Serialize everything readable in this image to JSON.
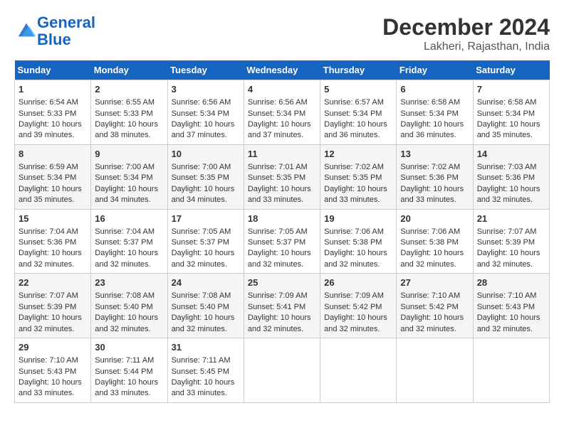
{
  "header": {
    "logo_line1": "General",
    "logo_line2": "Blue",
    "title": "December 2024",
    "subtitle": "Lakheri, Rajasthan, India"
  },
  "days_of_week": [
    "Sunday",
    "Monday",
    "Tuesday",
    "Wednesday",
    "Thursday",
    "Friday",
    "Saturday"
  ],
  "weeks": [
    [
      {
        "day": "1",
        "sunrise": "6:54 AM",
        "sunset": "5:33 PM",
        "daylight": "10 hours and 39 minutes."
      },
      {
        "day": "2",
        "sunrise": "6:55 AM",
        "sunset": "5:33 PM",
        "daylight": "10 hours and 38 minutes."
      },
      {
        "day": "3",
        "sunrise": "6:56 AM",
        "sunset": "5:34 PM",
        "daylight": "10 hours and 37 minutes."
      },
      {
        "day": "4",
        "sunrise": "6:56 AM",
        "sunset": "5:34 PM",
        "daylight": "10 hours and 37 minutes."
      },
      {
        "day": "5",
        "sunrise": "6:57 AM",
        "sunset": "5:34 PM",
        "daylight": "10 hours and 36 minutes."
      },
      {
        "day": "6",
        "sunrise": "6:58 AM",
        "sunset": "5:34 PM",
        "daylight": "10 hours and 36 minutes."
      },
      {
        "day": "7",
        "sunrise": "6:58 AM",
        "sunset": "5:34 PM",
        "daylight": "10 hours and 35 minutes."
      }
    ],
    [
      {
        "day": "8",
        "sunrise": "6:59 AM",
        "sunset": "5:34 PM",
        "daylight": "10 hours and 35 minutes."
      },
      {
        "day": "9",
        "sunrise": "7:00 AM",
        "sunset": "5:34 PM",
        "daylight": "10 hours and 34 minutes."
      },
      {
        "day": "10",
        "sunrise": "7:00 AM",
        "sunset": "5:35 PM",
        "daylight": "10 hours and 34 minutes."
      },
      {
        "day": "11",
        "sunrise": "7:01 AM",
        "sunset": "5:35 PM",
        "daylight": "10 hours and 33 minutes."
      },
      {
        "day": "12",
        "sunrise": "7:02 AM",
        "sunset": "5:35 PM",
        "daylight": "10 hours and 33 minutes."
      },
      {
        "day": "13",
        "sunrise": "7:02 AM",
        "sunset": "5:36 PM",
        "daylight": "10 hours and 33 minutes."
      },
      {
        "day": "14",
        "sunrise": "7:03 AM",
        "sunset": "5:36 PM",
        "daylight": "10 hours and 32 minutes."
      }
    ],
    [
      {
        "day": "15",
        "sunrise": "7:04 AM",
        "sunset": "5:36 PM",
        "daylight": "10 hours and 32 minutes."
      },
      {
        "day": "16",
        "sunrise": "7:04 AM",
        "sunset": "5:37 PM",
        "daylight": "10 hours and 32 minutes."
      },
      {
        "day": "17",
        "sunrise": "7:05 AM",
        "sunset": "5:37 PM",
        "daylight": "10 hours and 32 minutes."
      },
      {
        "day": "18",
        "sunrise": "7:05 AM",
        "sunset": "5:37 PM",
        "daylight": "10 hours and 32 minutes."
      },
      {
        "day": "19",
        "sunrise": "7:06 AM",
        "sunset": "5:38 PM",
        "daylight": "10 hours and 32 minutes."
      },
      {
        "day": "20",
        "sunrise": "7:06 AM",
        "sunset": "5:38 PM",
        "daylight": "10 hours and 32 minutes."
      },
      {
        "day": "21",
        "sunrise": "7:07 AM",
        "sunset": "5:39 PM",
        "daylight": "10 hours and 32 minutes."
      }
    ],
    [
      {
        "day": "22",
        "sunrise": "7:07 AM",
        "sunset": "5:39 PM",
        "daylight": "10 hours and 32 minutes."
      },
      {
        "day": "23",
        "sunrise": "7:08 AM",
        "sunset": "5:40 PM",
        "daylight": "10 hours and 32 minutes."
      },
      {
        "day": "24",
        "sunrise": "7:08 AM",
        "sunset": "5:40 PM",
        "daylight": "10 hours and 32 minutes."
      },
      {
        "day": "25",
        "sunrise": "7:09 AM",
        "sunset": "5:41 PM",
        "daylight": "10 hours and 32 minutes."
      },
      {
        "day": "26",
        "sunrise": "7:09 AM",
        "sunset": "5:42 PM",
        "daylight": "10 hours and 32 minutes."
      },
      {
        "day": "27",
        "sunrise": "7:10 AM",
        "sunset": "5:42 PM",
        "daylight": "10 hours and 32 minutes."
      },
      {
        "day": "28",
        "sunrise": "7:10 AM",
        "sunset": "5:43 PM",
        "daylight": "10 hours and 32 minutes."
      }
    ],
    [
      {
        "day": "29",
        "sunrise": "7:10 AM",
        "sunset": "5:43 PM",
        "daylight": "10 hours and 33 minutes."
      },
      {
        "day": "30",
        "sunrise": "7:11 AM",
        "sunset": "5:44 PM",
        "daylight": "10 hours and 33 minutes."
      },
      {
        "day": "31",
        "sunrise": "7:11 AM",
        "sunset": "5:45 PM",
        "daylight": "10 hours and 33 minutes."
      },
      null,
      null,
      null,
      null
    ]
  ]
}
